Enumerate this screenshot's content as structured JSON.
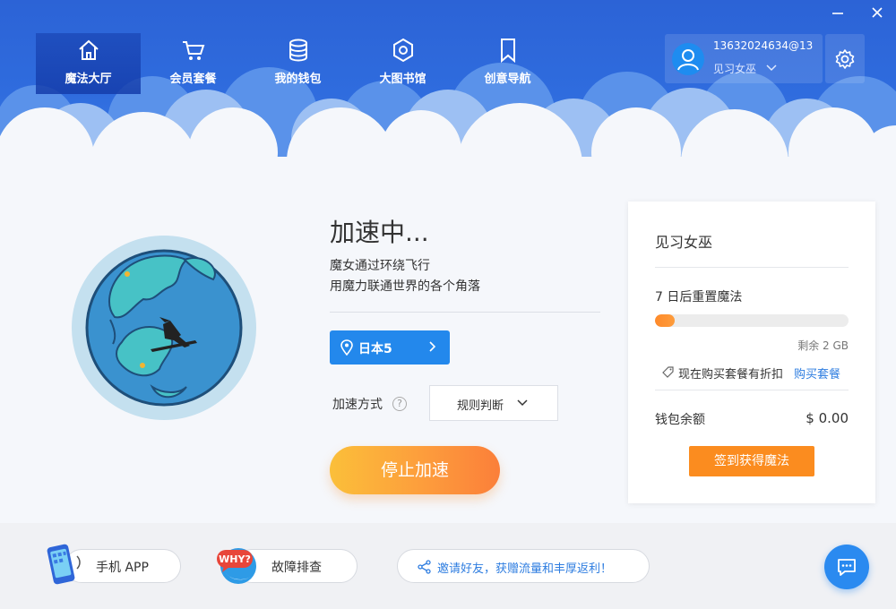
{
  "window": {
    "minimize_icon": "minimize-icon",
    "close_icon": "close-icon"
  },
  "nav": {
    "items": [
      {
        "label": "魔法大厅",
        "icon": "home-icon",
        "active": true
      },
      {
        "label": "会员套餐",
        "icon": "cart-icon"
      },
      {
        "label": "我的钱包",
        "icon": "coins-icon"
      },
      {
        "label": "大图书馆",
        "icon": "hexagon-icon"
      },
      {
        "label": "创意导航",
        "icon": "bookmark-icon"
      }
    ]
  },
  "user": {
    "email": "13632024634@13",
    "level": "见习女巫"
  },
  "status": {
    "title": "加速中...",
    "line1": "魔女通过环绕飞行",
    "line2": "用魔力联通世界的各个角落"
  },
  "node": {
    "label": "日本5"
  },
  "mode": {
    "label": "加速方式",
    "help": "?",
    "value": "规则判断"
  },
  "stop_button": "停止加速",
  "card": {
    "title": "见习女巫",
    "reset_text": "7 日后重置魔法",
    "progress_fraction": 0.1,
    "remaining": "剩余 2 GB",
    "promo": "现在购买套餐有折扣",
    "buy_link": "购买套餐",
    "wallet_label": "钱包余额",
    "wallet_value": "$ 0.00",
    "sign_button": "签到获得魔法"
  },
  "bottom": {
    "mobile_app": "手机 APP",
    "troubleshoot": "故障排查",
    "invite": "邀请好友，获赠流量和丰厚返利！",
    "why_badge": "WHY?"
  },
  "colors": {
    "header": "#2f6cde",
    "accent": "#2388ec",
    "orange": "#fb8c1f"
  }
}
